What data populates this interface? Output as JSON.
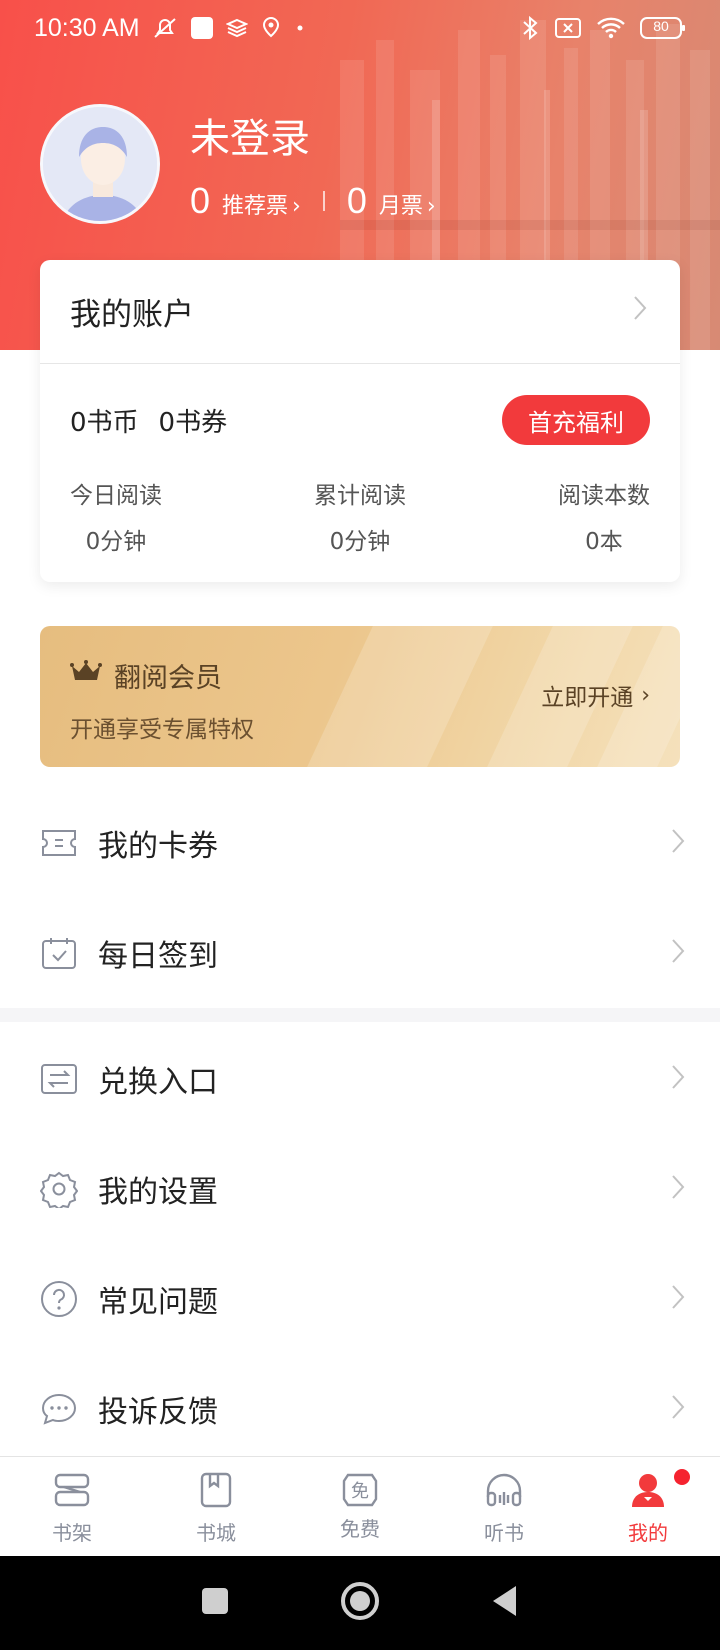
{
  "status_bar": {
    "time": "10:30 AM",
    "battery": "80",
    "icons": [
      "bell-off-icon",
      "app-square-icon",
      "layers-icon",
      "location-icon",
      "dot-icon",
      "bluetooth-icon",
      "no-sim-icon",
      "wifi-icon",
      "battery-icon"
    ]
  },
  "profile": {
    "username": "未登录",
    "recommend_ticket_count": "0",
    "recommend_ticket_label": "推荐票",
    "monthly_ticket_count": "0",
    "monthly_ticket_label": "月票"
  },
  "account": {
    "title": "我的账户",
    "coins": "0书币",
    "vouchers": "0书券",
    "first_charge_button": "首充福利",
    "stats": [
      {
        "label": "今日阅读",
        "value": "0分钟"
      },
      {
        "label": "累计阅读",
        "value": "0分钟"
      },
      {
        "label": "阅读本数",
        "value": "0本"
      }
    ]
  },
  "vip": {
    "title": "翻阅会员",
    "subtitle": "开通享受专属特权",
    "action": "立即开通"
  },
  "menu": [
    {
      "label": "我的卡券",
      "icon": "ticket-icon"
    },
    {
      "label": "每日签到",
      "icon": "calendar-check-icon"
    },
    {
      "label": "兑换入口",
      "icon": "exchange-icon"
    },
    {
      "label": "我的设置",
      "icon": "gear-icon"
    },
    {
      "label": "常见问题",
      "icon": "question-icon"
    },
    {
      "label": "投诉反馈",
      "icon": "chat-bubble-icon"
    }
  ],
  "tabs": [
    {
      "label": "书架",
      "icon": "bookshelf-icon",
      "active": false
    },
    {
      "label": "书城",
      "icon": "bookstore-icon",
      "active": false
    },
    {
      "label": "免费",
      "icon": "free-icon",
      "active": false,
      "icon_text": "免"
    },
    {
      "label": "听书",
      "icon": "headphones-icon",
      "active": false
    },
    {
      "label": "我的",
      "icon": "user-icon",
      "active": true
    }
  ],
  "colors": {
    "brand_red": "#f23a3c",
    "header_gradient_start": "#f8504a",
    "vip_gold": "#e6bd7f",
    "tab_inactive": "#8a8f9c"
  }
}
